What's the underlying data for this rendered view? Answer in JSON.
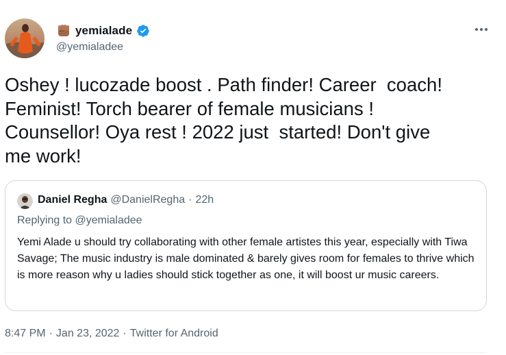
{
  "author": {
    "display_name": "yemialade",
    "handle": "@yemialadee",
    "verified": true,
    "name_emoji": "raised-fist-emoji",
    "avatar": "profile-photo"
  },
  "more_icon": "more-options-icon",
  "tweet": {
    "text": "Oshey ! lucozade boost . Path finder! Career  coach!\nFeminist! Torch bearer of female musicians !\nCounsellor! Oya rest ! 2022 just  started! Don't give\nme work!"
  },
  "quoted_tweet": {
    "display_name": "Daniel Regha",
    "handle": "@DanielRegha",
    "separator": "·",
    "time": "22h",
    "replying_to": "Replying to @yemialadee",
    "text": "Yemi Alade u should try collaborating with other female artistes this year, especially with Tiwa Savage; The music industry is male dominated & barely gives room for females to thrive which is more reason why u ladies should stick together as one, it will boost ur music careers."
  },
  "meta": {
    "time": "8:47 PM",
    "sep1": "·",
    "date": "Jan 23, 2022",
    "sep2": "·",
    "source": "Twitter for Android"
  },
  "colors": {
    "text": "#0f1419",
    "secondary": "#536471",
    "verified": "#1d9bf0",
    "border": "#cfd9de"
  }
}
